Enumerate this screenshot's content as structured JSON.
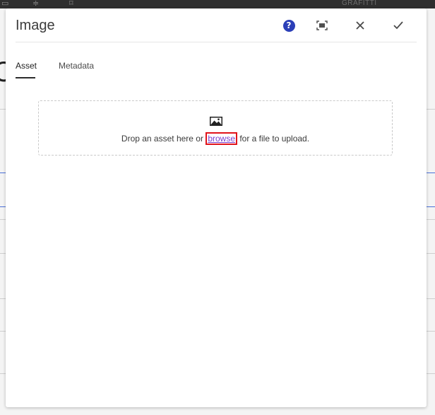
{
  "background": {
    "topbar_label": "GRAFITTI",
    "big_letter": "C"
  },
  "dialog": {
    "title": "Image",
    "header_icons": {
      "help": "help-icon",
      "fullscreen": "fullscreen-icon",
      "close": "close-icon",
      "done": "checkmark-icon"
    },
    "help_glyph": "?",
    "tabs": [
      {
        "label": "Asset",
        "active": true
      },
      {
        "label": "Metadata",
        "active": false
      }
    ],
    "dropzone": {
      "icon": "image-icon",
      "text_before": "Drop an asset here or ",
      "link_label": "browse",
      "text_after": " for a file to upload."
    }
  },
  "colors": {
    "help_blue": "#2b3fb8",
    "link_purple": "#7a3fcf",
    "highlight_red": "#e0131b"
  }
}
